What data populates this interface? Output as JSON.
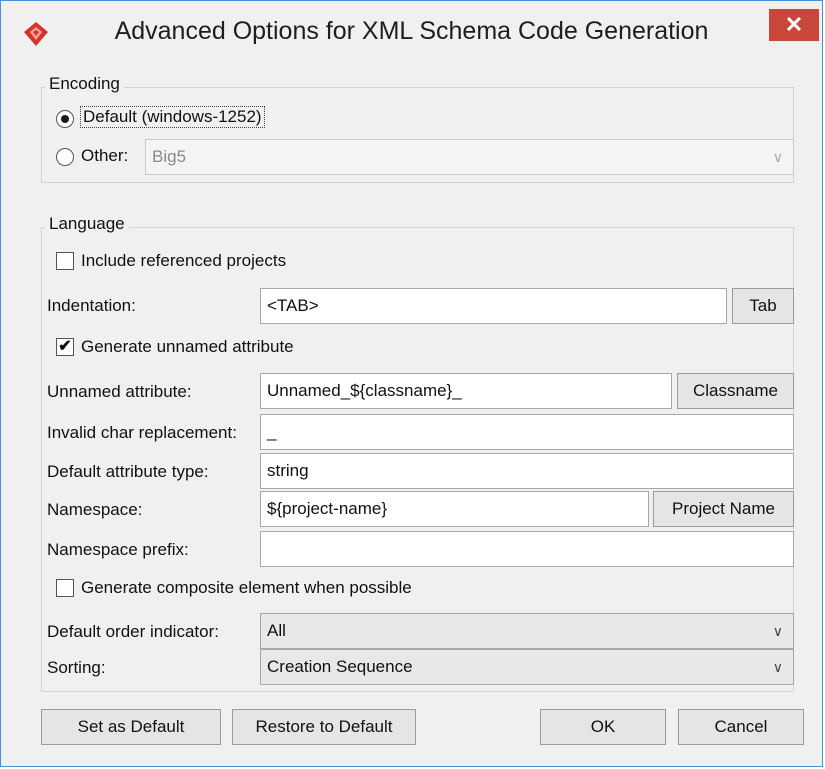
{
  "window": {
    "title": "Advanced Options for XML Schema Code Generation",
    "close_label": "✕"
  },
  "encoding": {
    "legend": "Encoding",
    "default_label": "Default (windows-1252)",
    "other_label": "Other:",
    "other_value": "Big5"
  },
  "language": {
    "legend": "Language",
    "include_projects_label": "Include referenced projects",
    "indentation_label": "Indentation:",
    "indentation_value": "<TAB>",
    "tab_button": "Tab",
    "generate_unnamed_label": "Generate unnamed attribute",
    "generate_unnamed_mark": "✔",
    "unnamed_attr_label": "Unnamed attribute:",
    "unnamed_attr_value": "Unnamed_${classname}_",
    "classname_button": "Classname",
    "invalid_char_label": "Invalid char replacement:",
    "invalid_char_value": "_",
    "default_attr_type_label": "Default attribute type:",
    "default_attr_type_value": "string",
    "namespace_label": "Namespace:",
    "namespace_value": "${project-name}",
    "project_name_button": "Project Name",
    "namespace_prefix_label": "Namespace prefix:",
    "namespace_prefix_value": "",
    "composite_label": "Generate composite element when possible",
    "order_indicator_label": "Default order indicator:",
    "order_indicator_value": "All",
    "sorting_label": "Sorting:",
    "sorting_value": "Creation Sequence"
  },
  "footer": {
    "set_default": "Set as Default",
    "restore_default": "Restore to Default",
    "ok": "OK",
    "cancel": "Cancel"
  },
  "icons": {
    "app": "visual-paradigm-logo",
    "chevron": "chevron-down-icon"
  },
  "colors": {
    "close": "#c7473a",
    "logo": "#d8322a",
    "border": "#4a90d9"
  }
}
